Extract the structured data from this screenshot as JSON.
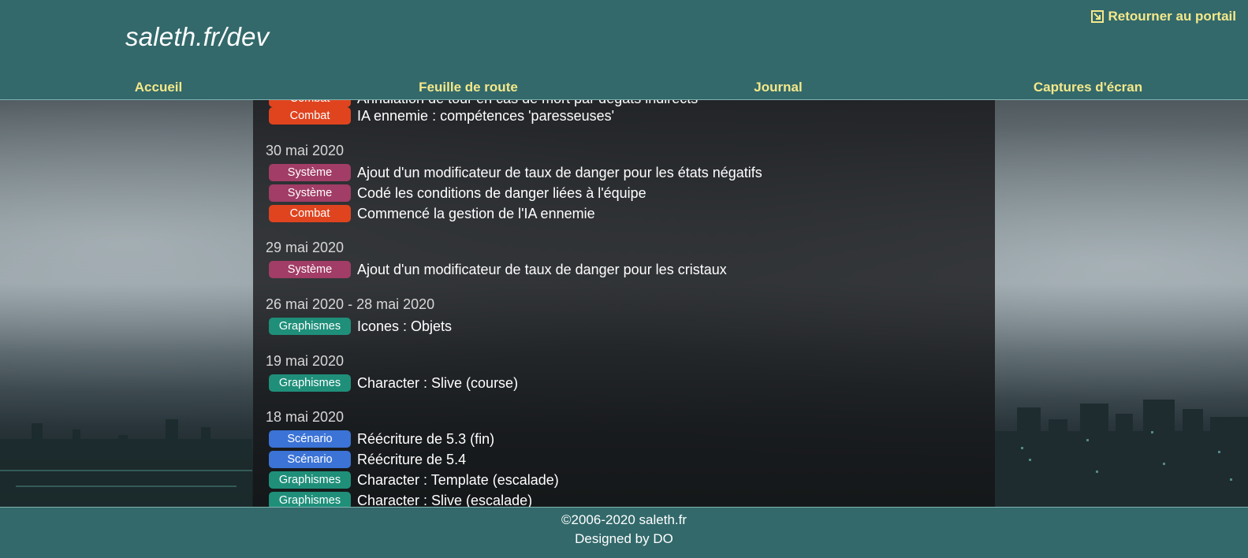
{
  "header": {
    "site_title": "saleth.fr/dev",
    "portal_link": "Retourner au portail",
    "nav": [
      "Accueil",
      "Feuille de route",
      "Journal",
      "Captures d'écran"
    ]
  },
  "colors": {
    "header_bg": "#33696b",
    "link": "#f4e88a",
    "combat": "#e0441f",
    "systeme": "#a13d66",
    "graphismes": "#1f8f7a",
    "scenario": "#3b73d6"
  },
  "journal": {
    "partial_top": {
      "category": "Combat",
      "text": "Annulation de tour en cas de mort par dégâts indirects"
    },
    "groups": [
      {
        "date": "",
        "entries": [
          {
            "category": "Combat",
            "text": "IA ennemie : compétences 'paresseuses'"
          }
        ]
      },
      {
        "date": "30 mai 2020",
        "entries": [
          {
            "category": "Système",
            "text": "Ajout d'un modificateur de taux de danger pour les états négatifs"
          },
          {
            "category": "Système",
            "text": "Codé les conditions de danger liées à l'équipe"
          },
          {
            "category": "Combat",
            "text": "Commencé la gestion de l'IA ennemie"
          }
        ]
      },
      {
        "date": "29 mai 2020",
        "entries": [
          {
            "category": "Système",
            "text": "Ajout d'un modificateur de taux de danger pour les cristaux"
          }
        ]
      },
      {
        "date": "26 mai 2020 - 28 mai 2020",
        "entries": [
          {
            "category": "Graphismes",
            "text": "Icones : Objets"
          }
        ]
      },
      {
        "date": "19 mai 2020",
        "entries": [
          {
            "category": "Graphismes",
            "text": "Character : Slive (course)"
          }
        ]
      },
      {
        "date": "18 mai 2020",
        "entries": [
          {
            "category": "Scénario",
            "text": "Réécriture de 5.3 (fin)"
          },
          {
            "category": "Scénario",
            "text": "Réécriture de 5.4"
          },
          {
            "category": "Graphismes",
            "text": "Character : Template (escalade)"
          },
          {
            "category": "Graphismes",
            "text": "Character : Slive (escalade)"
          }
        ]
      }
    ]
  },
  "footer": {
    "copyright": "©2006-2020 saleth.fr",
    "designed": "Designed by DO"
  }
}
